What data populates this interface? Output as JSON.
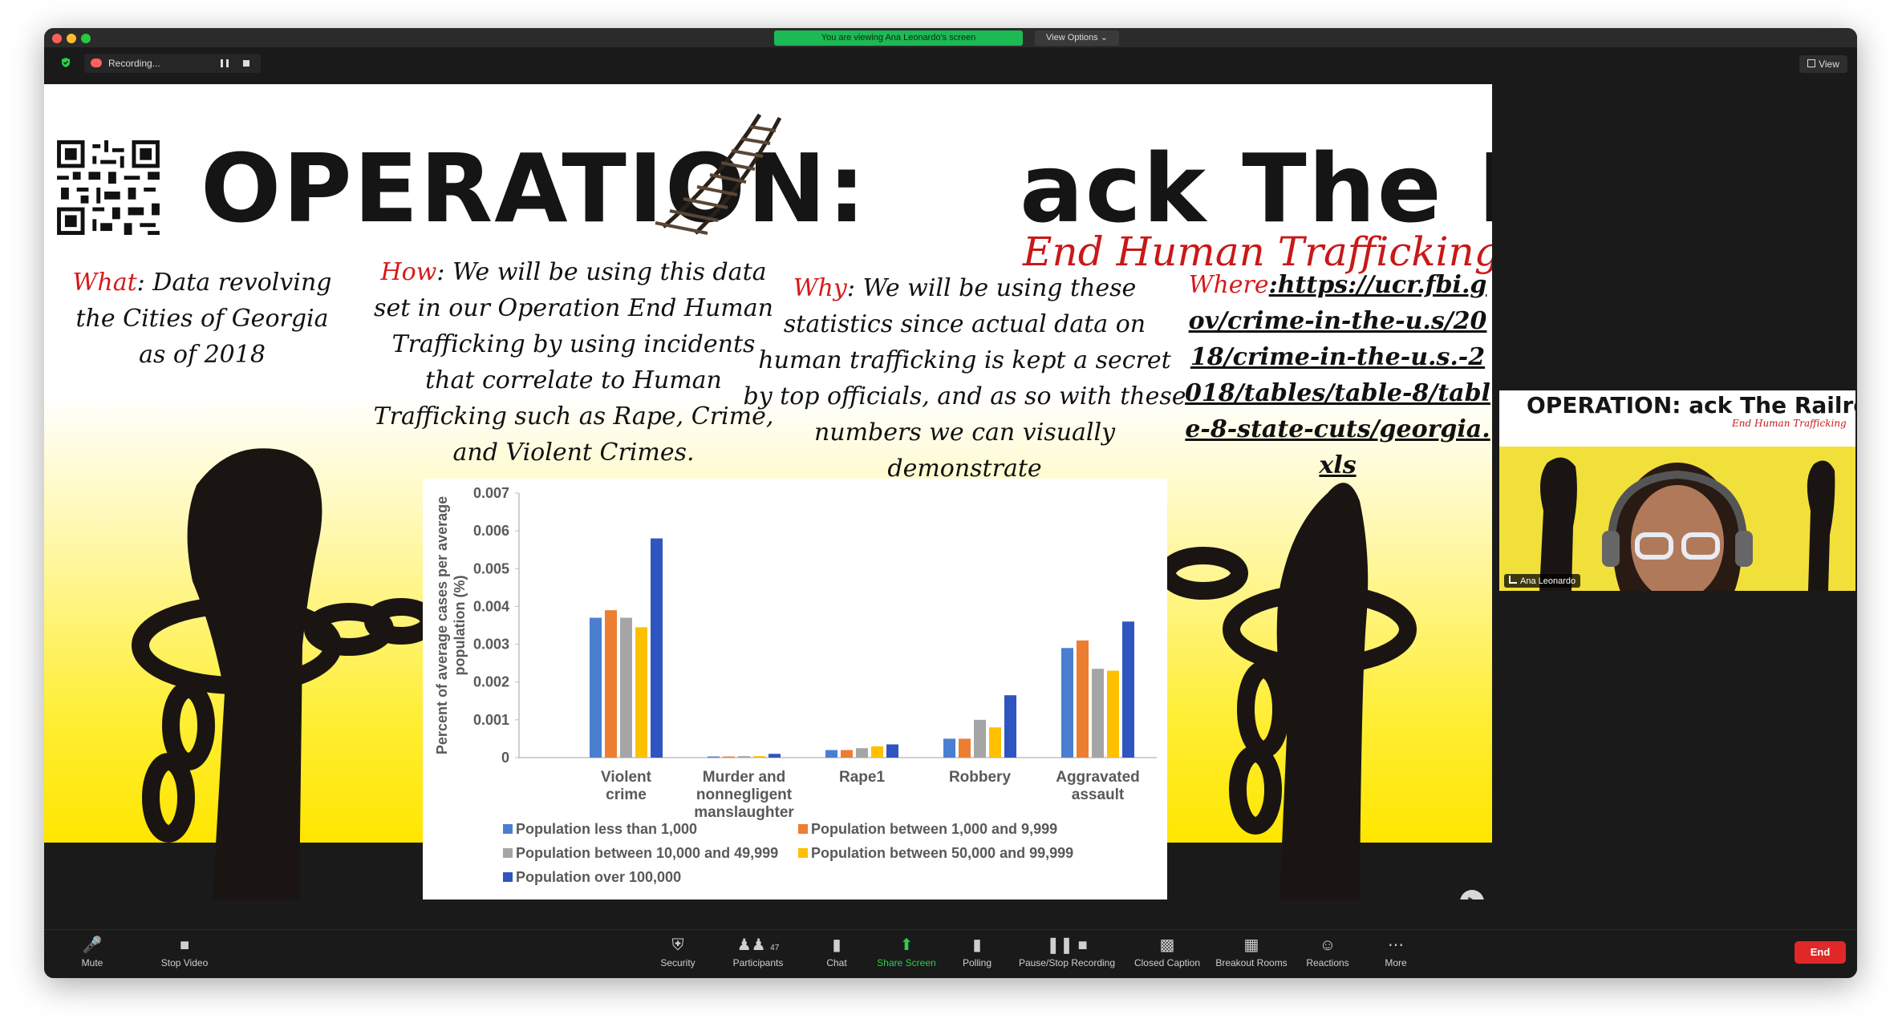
{
  "titlebar": {
    "banner": "You are viewing Ana Leonardo's screen",
    "view_options": "View Options ⌄"
  },
  "recording": {
    "label": "Recording...",
    "pause_icon": "pause-icon",
    "stop_icon": "stop-icon"
  },
  "view_button": "View",
  "slide": {
    "title_left": "OPERATION:",
    "title_right": "ack The RailroaD",
    "subtitle": "End Human Trafficking",
    "what_key": "What",
    "what_text": ": Data revolving the Cities of Georgia as of 2018",
    "how_key": "How",
    "how_text": ": We will be using this data set in our Operation End Human Trafficking by using incidents that correlate to Human Trafficking such as Rape, Crime, and Violent Crimes.",
    "why_key": "Why",
    "why_text": ": We will be using these statistics since actual data on human trafficking is kept a secret by top officials, and as so with these numbers we can visually demonstrate",
    "where_key": "Where",
    "where_url": ":https://ucr.fbi.gov/crime-in-the-u.s/2018/crime-in-the-u.s.-2018/tables/table-8/table-8-state-cuts/georgia.xls"
  },
  "chart_data": {
    "type": "bar",
    "ylabel": "Percent of average cases per average population (%)",
    "ylim": [
      0,
      0.007
    ],
    "yticks": [
      "0",
      "0.001",
      "0.002",
      "0.003",
      "0.004",
      "0.005",
      "0.006",
      "0.007"
    ],
    "categories": [
      "Violent crime",
      "Murder and nonnegligent manslaughter",
      "Rape1",
      "Robbery",
      "Aggravated assault"
    ],
    "category_lines": [
      [
        "Violent",
        "crime"
      ],
      [
        "Murder and",
        "nonnegligent",
        "manslaughter"
      ],
      [
        "Rape1"
      ],
      [
        "Robbery"
      ],
      [
        "Aggravated",
        "assault"
      ]
    ],
    "series": [
      {
        "name": "Population less than 1,000",
        "color": "#4a7fd0",
        "values": [
          0.0037,
          3e-05,
          0.0002,
          0.0005,
          0.0029
        ]
      },
      {
        "name": "Population between 1,000 and 9,999",
        "color": "#ed7d31",
        "values": [
          0.0039,
          3e-05,
          0.0002,
          0.0005,
          0.0031
        ]
      },
      {
        "name": "Population between 10,000 and 49,999",
        "color": "#a5a5a5",
        "values": [
          0.0037,
          4e-05,
          0.00025,
          0.001,
          0.00235
        ]
      },
      {
        "name": "Population between 50,000 and 99,999",
        "color": "#ffc000",
        "values": [
          0.00345,
          4e-05,
          0.0003,
          0.0008,
          0.0023
        ]
      },
      {
        "name": "Population over 100,000",
        "color": "#2f55c0",
        "values": [
          0.0058,
          0.0001,
          0.00035,
          0.00165,
          0.0036
        ]
      }
    ],
    "legend": "bottom",
    "grid": false
  },
  "participant": {
    "name": "Ana Leonardo",
    "tile_title": "OPERATION: ack The RailroaD",
    "tile_subtitle": "End Human Trafficking"
  },
  "toolbar": {
    "mute": "Mute",
    "stop_video": "Stop Video",
    "security": "Security",
    "participants": "Participants",
    "participants_count": "47",
    "chat": "Chat",
    "share_screen": "Share Screen",
    "polling": "Polling",
    "pause_recording": "Pause/Stop Recording",
    "closed_caption": "Closed Caption",
    "breakout_rooms": "Breakout Rooms",
    "reactions": "Reactions",
    "more": "More",
    "end": "End"
  }
}
